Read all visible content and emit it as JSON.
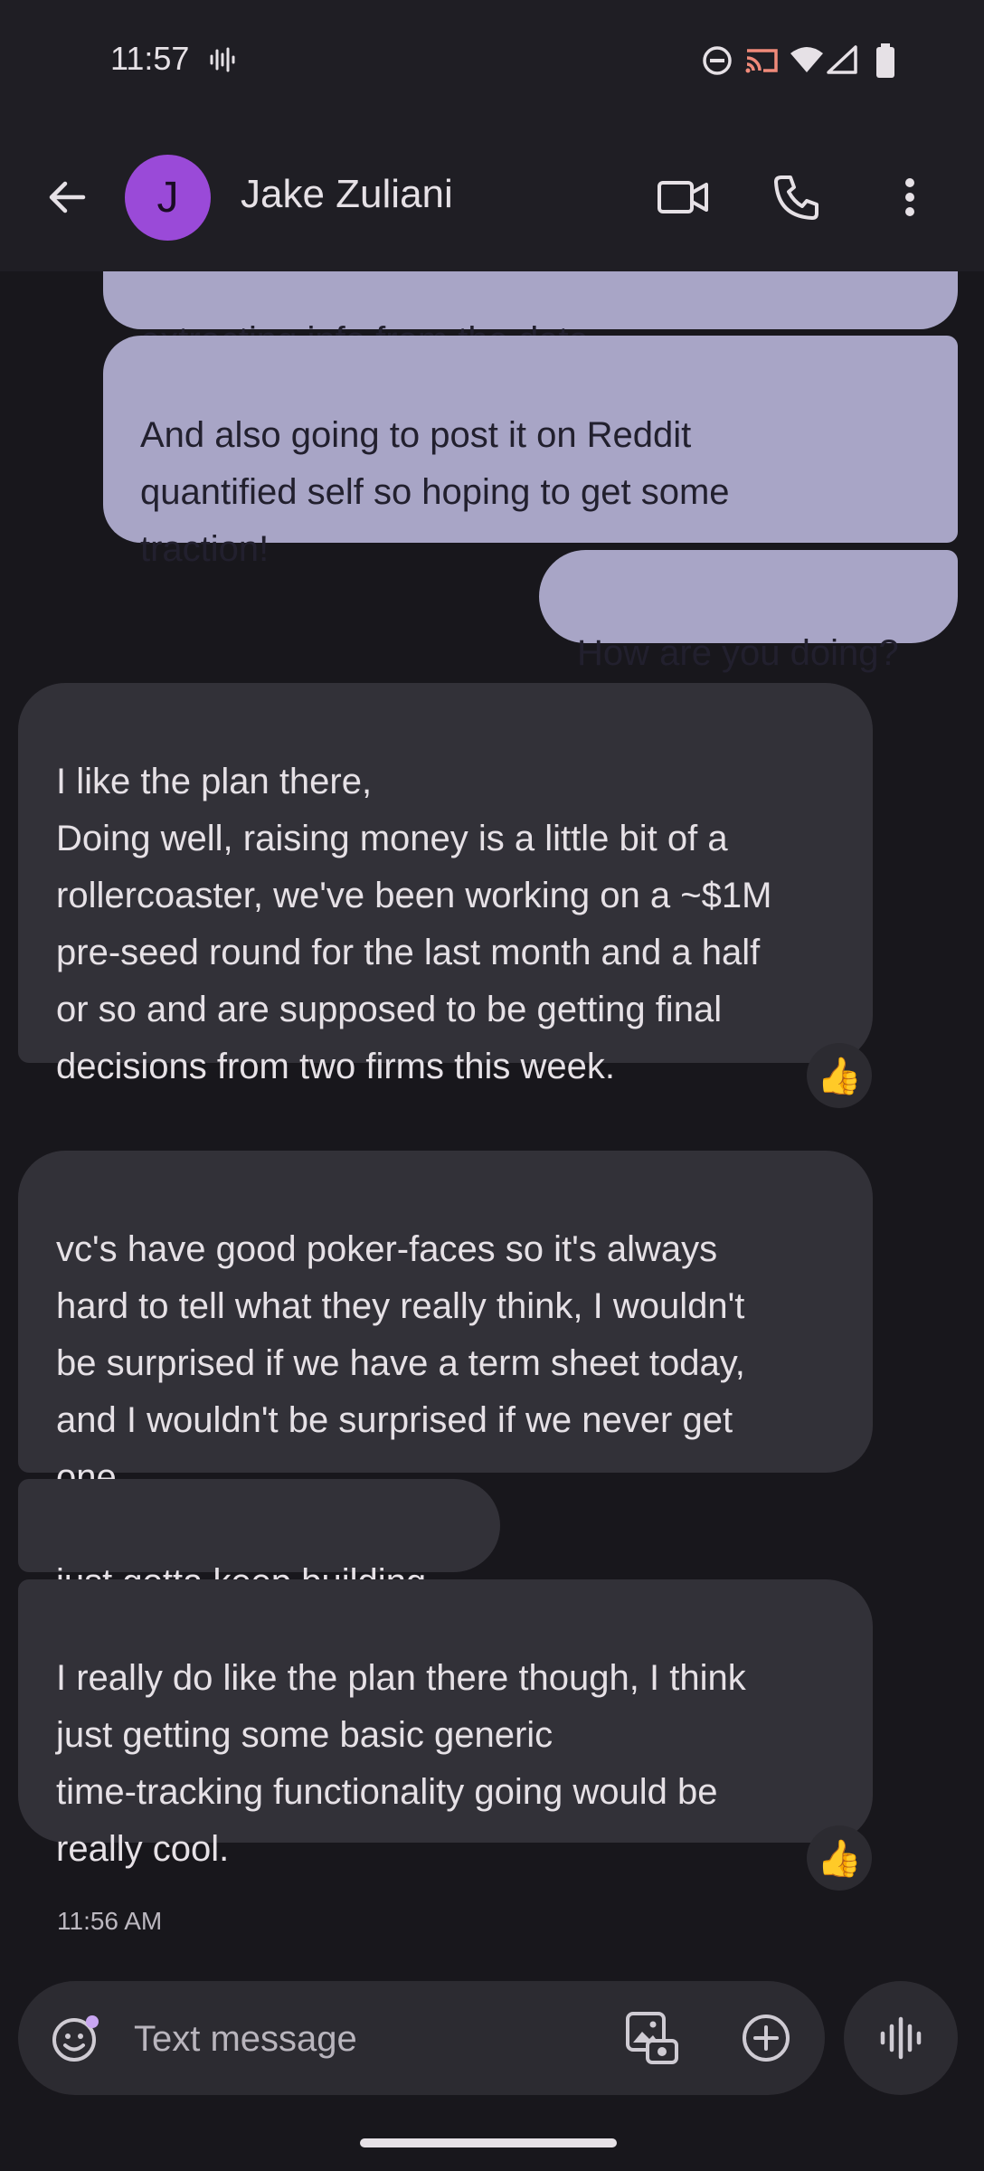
{
  "status_bar": {
    "time": "11:57"
  },
  "header": {
    "avatar_letter": "J",
    "contact_name": "Jake Zuliani"
  },
  "messages": [
    {
      "direction": "outgoing",
      "text": "extracting info from the data"
    },
    {
      "direction": "outgoing",
      "text": "And also going to post it on Reddit\nquantified self so hoping to get some\ntraction!"
    },
    {
      "direction": "outgoing",
      "text": "How are you doing?"
    },
    {
      "direction": "incoming",
      "text": "I like the plan there,\nDoing well, raising money is a little bit of a\nrollercoaster, we've been working on a ~$1M\npre-seed round for the last month and a half\nor so and are supposed to be getting final\ndecisions from two firms this week.",
      "reaction": "👍"
    },
    {
      "direction": "incoming",
      "text": "vc's have good poker-faces so it's always\nhard to tell what they really think, I wouldn't\nbe surprised if we have a term sheet today,\nand I wouldn't be surprised if we never get\none."
    },
    {
      "direction": "incoming",
      "text": "just gotta keep building"
    },
    {
      "direction": "incoming",
      "text": "I really do like the plan there though, I think\njust getting some basic generic\ntime-tracking functionality going would be\nreally cool.",
      "reaction": "👍"
    }
  ],
  "timestamp": "11:56 AM",
  "compose": {
    "placeholder": "Text message"
  },
  "icons": {
    "status": [
      "voice-activity-icon",
      "do-not-disturb-icon",
      "cast-icon",
      "wifi-icon",
      "signal-icon",
      "battery-icon"
    ],
    "header": [
      "back-arrow-icon",
      "video-call-icon",
      "phone-icon",
      "more-vert-icon"
    ],
    "compose": [
      "emoji-icon",
      "gallery-icon",
      "add-icon",
      "voice-message-icon"
    ]
  },
  "colors": {
    "background": "#18171c",
    "outgoing_bubble": "#a8a5c6",
    "incoming_bubble": "#323138",
    "avatar": "#9a4ad8"
  }
}
